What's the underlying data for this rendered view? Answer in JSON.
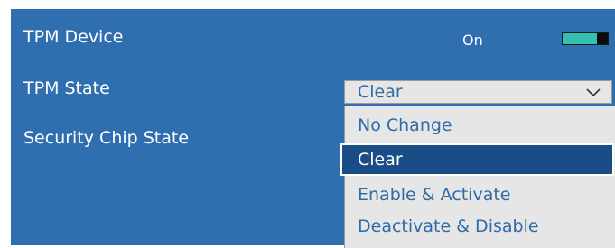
{
  "rows": {
    "tpm_device": {
      "label": "TPM Device",
      "value": "On",
      "toggle_on": true
    },
    "tpm_state": {
      "label": "TPM State",
      "value": "Clear"
    },
    "security_chip_state": {
      "label": "Security Chip State"
    }
  },
  "dropdown": {
    "options": [
      "No Change",
      "Clear",
      "Enable & Activate",
      "Deactivate & Disable"
    ],
    "selected": "Clear"
  },
  "colors": {
    "panel_bg": "#2f6eaf",
    "toggle_accent": "#35c0b0",
    "option_text": "#2e6ba8",
    "selected_bg": "#1a4c86",
    "list_bg": "#e6e6e6"
  },
  "icons": {
    "select_arrow": "chevron-down-icon"
  }
}
